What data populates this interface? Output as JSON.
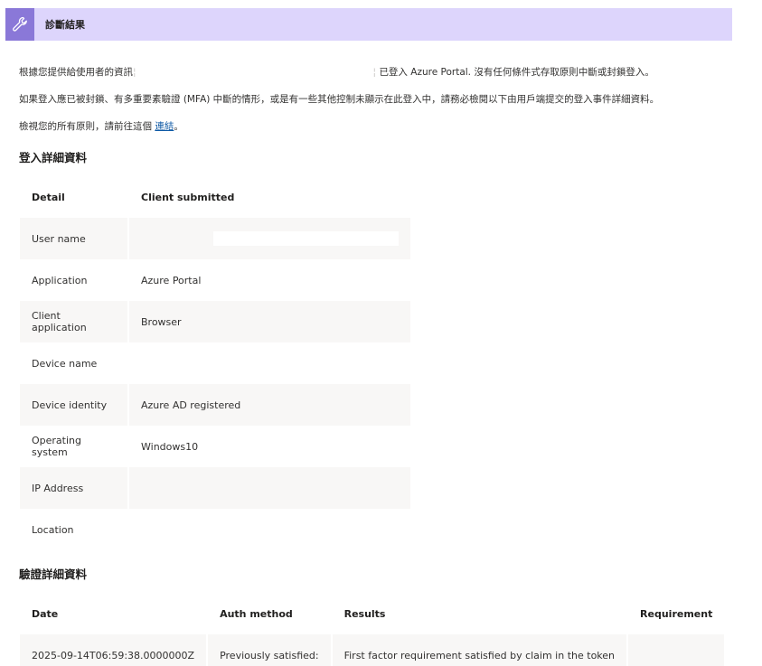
{
  "banner": {
    "icon": "wrench-icon",
    "title": "診斷結果"
  },
  "summary": {
    "line1_prefix": "根據您提供給使用者的資訊",
    "line1_suffix": "已登入 Azure Portal. 沒有任何條件式存取原則中斷或封鎖登入。",
    "line2": "如果登入應已被封鎖、有多重要素驗證 (MFA) 中斷的情形，或是有一些其他控制未顯示在此登入中，請務必檢閱以下由用戶端提交的登入事件詳細資料。",
    "line3_prefix": "檢視您的所有原則，請前往這個",
    "line3_link": "連結",
    "line3_suffix": "。"
  },
  "signin_details": {
    "title": "登入詳細資料",
    "headers": [
      "Detail",
      "Client submitted"
    ],
    "rows": [
      {
        "label": "User name",
        "value": ""
      },
      {
        "label": "Application",
        "value": "Azure Portal"
      },
      {
        "label": "Client application",
        "value": "Browser"
      },
      {
        "label": "Device name",
        "value": ""
      },
      {
        "label": "Device identity",
        "value": "Azure AD registered"
      },
      {
        "label": "Operating system",
        "value": "Windows10"
      },
      {
        "label": "IP Address",
        "value": ""
      },
      {
        "label": "Location",
        "value": ""
      }
    ]
  },
  "auth_details": {
    "title": "驗證詳細資料",
    "headers": [
      "Date",
      "Auth method",
      "Results",
      "Requirement"
    ],
    "rows": [
      {
        "date": "2025-09-14T06:59:38.0000000Z",
        "method": "Previously satisfied:",
        "result": "First factor requirement satisfied by claim in the token",
        "requirement": ""
      }
    ]
  }
}
